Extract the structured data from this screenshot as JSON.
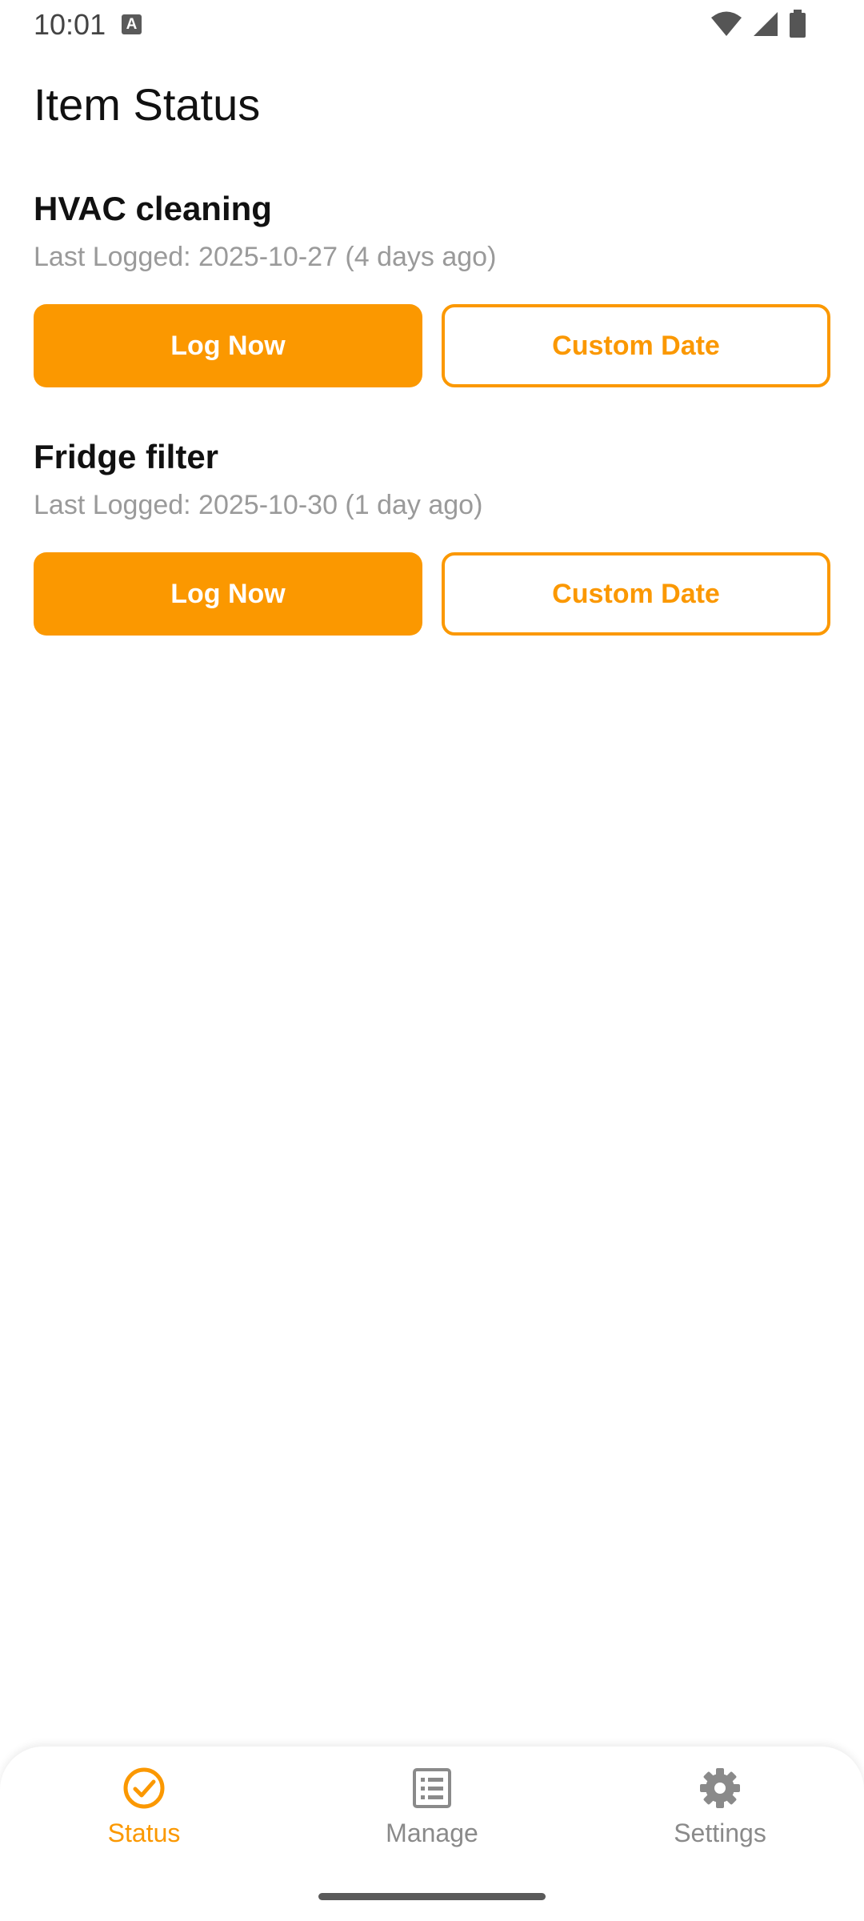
{
  "status_bar": {
    "time": "10:01",
    "a_icon_glyph": "A",
    "icons": [
      "a-notification-icon",
      "wifi-icon",
      "signal-icon",
      "battery-icon"
    ]
  },
  "page": {
    "title": "Item Status"
  },
  "items": [
    {
      "name": "HVAC cleaning",
      "last_logged": "Last Logged: 2025-10-27 (4 days ago)",
      "log_now_label": "Log Now",
      "custom_date_label": "Custom Date"
    },
    {
      "name": "Fridge filter",
      "last_logged": "Last Logged: 2025-10-30 (1 day ago)",
      "log_now_label": "Log Now",
      "custom_date_label": "Custom Date"
    }
  ],
  "bottom_nav": {
    "items": [
      {
        "label": "Status",
        "icon": "check-circle-icon",
        "active": true
      },
      {
        "label": "Manage",
        "icon": "list-icon",
        "active": false
      },
      {
        "label": "Settings",
        "icon": "gear-icon",
        "active": false
      }
    ]
  },
  "colors": {
    "accent": "#fb9800",
    "inactive_text": "#8a8a8a",
    "secondary_text": "#9a9a9a"
  }
}
